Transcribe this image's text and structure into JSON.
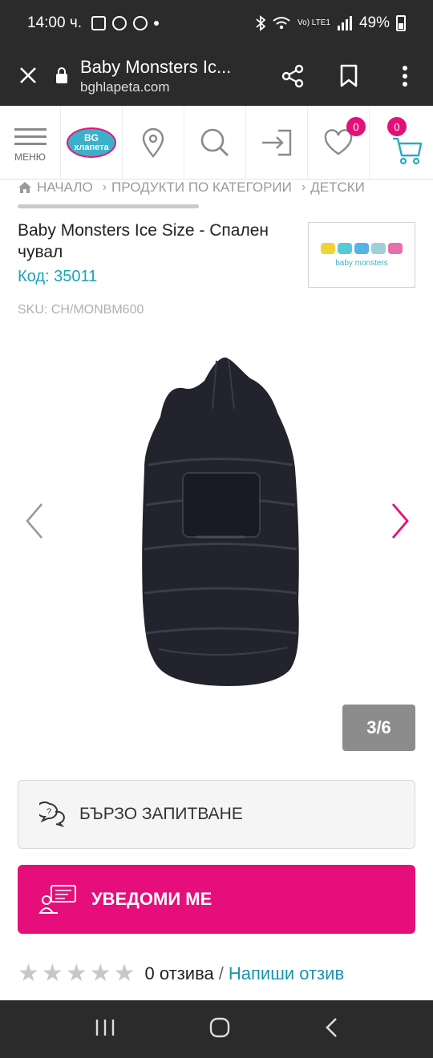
{
  "status_bar": {
    "time": "14:00 ч.",
    "lte": "Vo) LTE1",
    "battery": "49%"
  },
  "browser": {
    "page_title": "Baby Monsters Ic...",
    "url": "bghlapeta.com"
  },
  "header": {
    "menu_label": "МЕНЮ",
    "logo_top": "BG",
    "logo_bottom": "хлапета",
    "wishlist_count": "0",
    "cart_count": "0"
  },
  "breadcrumb": {
    "items": [
      "НАЧАЛО",
      "ПРОДУКТИ ПО КАТЕГОРИИ",
      "ДЕТСКИ"
    ]
  },
  "product": {
    "title": "Baby Monsters Ice Size - Спален чувал",
    "code": "Код: 35011",
    "sku": "SKU: CH/MONBM600",
    "brand": "baby monsters"
  },
  "gallery": {
    "counter": "3/6",
    "current": 3,
    "total": 6
  },
  "actions": {
    "quick_question": "БЪРЗО ЗАПИТВАНЕ",
    "notify_me": "УВЕДОМИ МЕ"
  },
  "reviews": {
    "rating": 0,
    "count_text": "0 отзива",
    "separator": "/",
    "write_review": "Напиши отзив"
  },
  "colors": {
    "accent_pink": "#e50e7a",
    "accent_teal": "#18a3b8",
    "system_bar": "#2b2b2b"
  }
}
